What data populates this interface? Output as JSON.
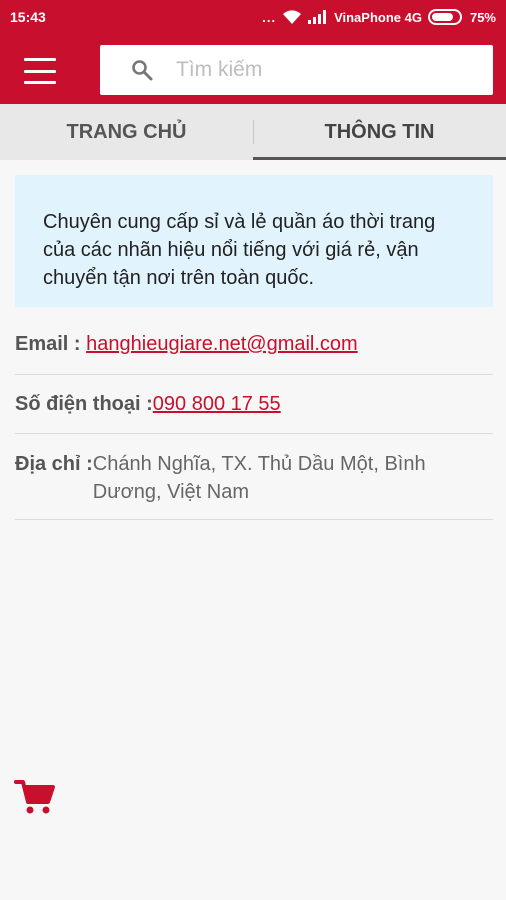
{
  "status": {
    "time": "15:43",
    "dots": "...",
    "carrier": "VinaPhone 4G",
    "battery": "75%"
  },
  "search": {
    "placeholder": "Tìm kiếm",
    "value": ""
  },
  "tabs": [
    {
      "label": "TRANG CHỦ",
      "active": false
    },
    {
      "label": "THÔNG TIN",
      "active": true
    }
  ],
  "intro": {
    "text": "Chuyên cung cấp sỉ và lẻ quần áo thời trang của các nhãn hiệu nổi tiếng với giá rẻ, vận chuyển tận nơi trên toàn quốc."
  },
  "info": {
    "email_label": "Email : ",
    "email_value": "hanghieugiare.net@gmail.com",
    "phone_label": "Số điện thoại :",
    "phone_value": "090 800 17 55",
    "address_label": "Địa chỉ :",
    "address_value": "Chánh Nghĩa, TX. Thủ Dầu Một, Bình Dương, Việt Nam"
  },
  "colors": {
    "brand": "#c8102e",
    "intro_bg": "#e1f3fc"
  },
  "icons": [
    "wifi-icon",
    "signal-icon",
    "battery-icon",
    "menu-icon",
    "search-icon",
    "cart-icon"
  ]
}
